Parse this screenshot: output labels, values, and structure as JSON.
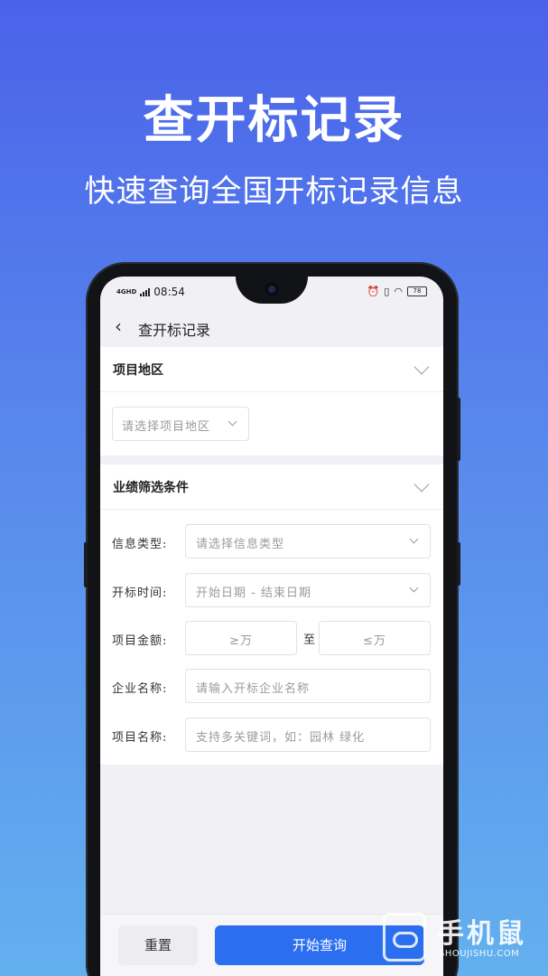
{
  "promo": {
    "title": "查开标记录",
    "subtitle": "快速查询全国开标记录信息"
  },
  "status_bar": {
    "network": "4GHD",
    "time": "08:54",
    "battery": "78"
  },
  "nav": {
    "title": "查开标记录"
  },
  "region_section": {
    "title": "项目地区",
    "select_placeholder": "请选择项目地区"
  },
  "filter_section": {
    "title": "业绩筛选条件",
    "info_type": {
      "label": "信息类型:",
      "placeholder": "请选择信息类型"
    },
    "bid_time": {
      "label": "开标时间:",
      "placeholder": "开始日期 - 结束日期"
    },
    "amount": {
      "label": "项目金额:",
      "min_placeholder": "≥万",
      "to": "至",
      "max_placeholder": "≤万"
    },
    "company": {
      "label": "企业名称:",
      "placeholder": "请输入开标企业名称"
    },
    "project": {
      "label": "项目名称:",
      "placeholder": "支持多关键词，如：园林 绿化"
    }
  },
  "actions": {
    "reset": "重置",
    "search": "开始查询"
  },
  "watermark": {
    "name": "手机鼠",
    "url": "SHOUJISHU.COM"
  }
}
